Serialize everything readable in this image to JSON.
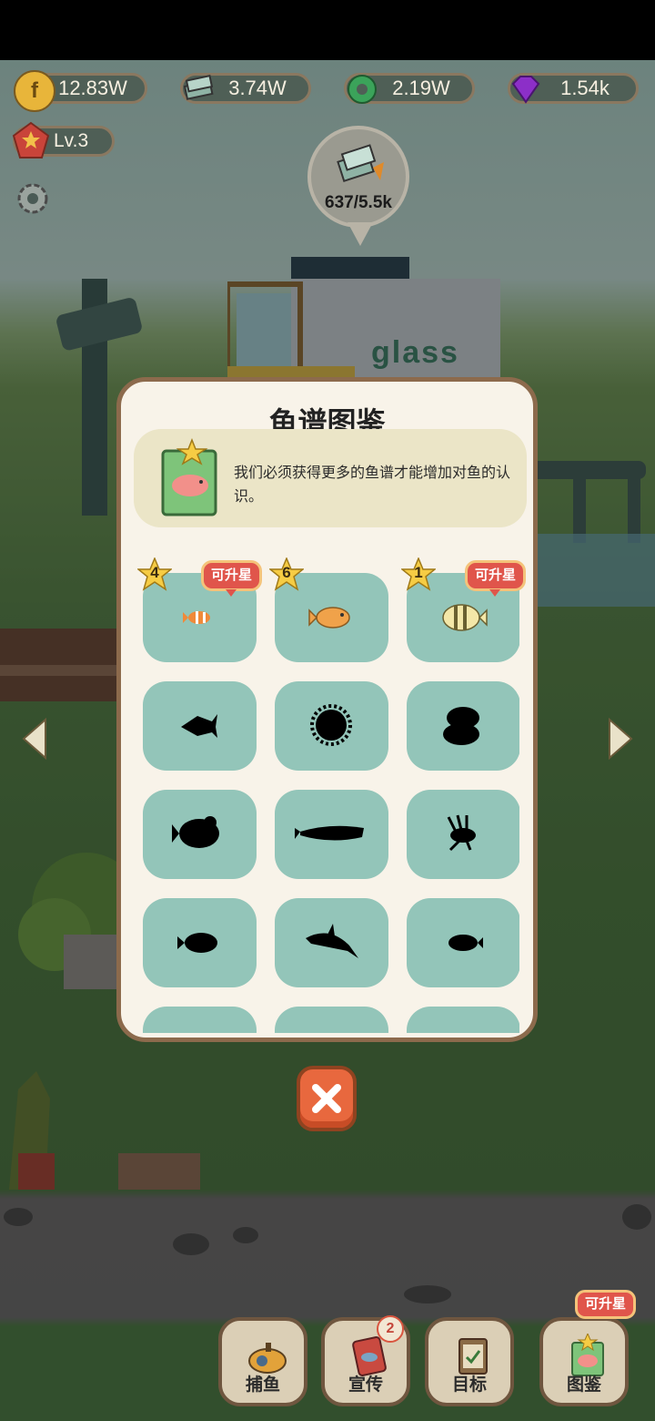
{
  "currencies": [
    {
      "id": "coin",
      "value": "12.83W",
      "icon": "coin-icon",
      "color": "#e8b53a"
    },
    {
      "id": "glass",
      "value": "3.74W",
      "icon": "glass-stack-icon",
      "color": "#8fb3a5"
    },
    {
      "id": "gear",
      "value": "2.19W",
      "icon": "green-gear-icon",
      "color": "#3ba35a"
    },
    {
      "id": "gem",
      "value": "1.54k",
      "icon": "purple-gem-icon",
      "color": "#8c2fc8"
    }
  ],
  "level": {
    "label": "Lv.3"
  },
  "factory": {
    "progress_text": "637/5.5k",
    "sign": "glass"
  },
  "dialog": {
    "title": "鱼谱图鉴",
    "description": "我们必须获得更多的鱼谱才能增加对鱼的认识。",
    "upgrade_tag": "可升星",
    "fish": [
      {
        "name": "clownfish",
        "count": "4",
        "unlocked": true,
        "can_upgrade": true
      },
      {
        "name": "orange-fish",
        "count": "6",
        "unlocked": true,
        "can_upgrade": false
      },
      {
        "name": "striped-fish",
        "count": "1",
        "unlocked": true,
        "can_upgrade": true
      },
      {
        "name": "angelfish-silhouette",
        "unlocked": false
      },
      {
        "name": "pufferfish-silhouette",
        "unlocked": false
      },
      {
        "name": "blob-fish-silhouette",
        "unlocked": false
      },
      {
        "name": "goldfish-silhouette",
        "unlocked": false
      },
      {
        "name": "arowana-silhouette",
        "unlocked": false
      },
      {
        "name": "lionfish-silhouette",
        "unlocked": false
      },
      {
        "name": "tang-silhouette",
        "unlocked": false
      },
      {
        "name": "shark-silhouette",
        "unlocked": false
      },
      {
        "name": "small-fish-silhouette",
        "unlocked": false
      }
    ]
  },
  "nav": [
    {
      "id": "fishing",
      "label": "捕鱼"
    },
    {
      "id": "promotion",
      "label": "宣传",
      "badge": "2"
    },
    {
      "id": "goals",
      "label": "目标"
    },
    {
      "id": "collection",
      "label": "图鉴",
      "tag": "可升星"
    }
  ],
  "colors": {
    "accent": "#e0554b",
    "panel": "#f8f3e9",
    "cell": "#93c5b9",
    "frame": "#8c6a4c"
  }
}
